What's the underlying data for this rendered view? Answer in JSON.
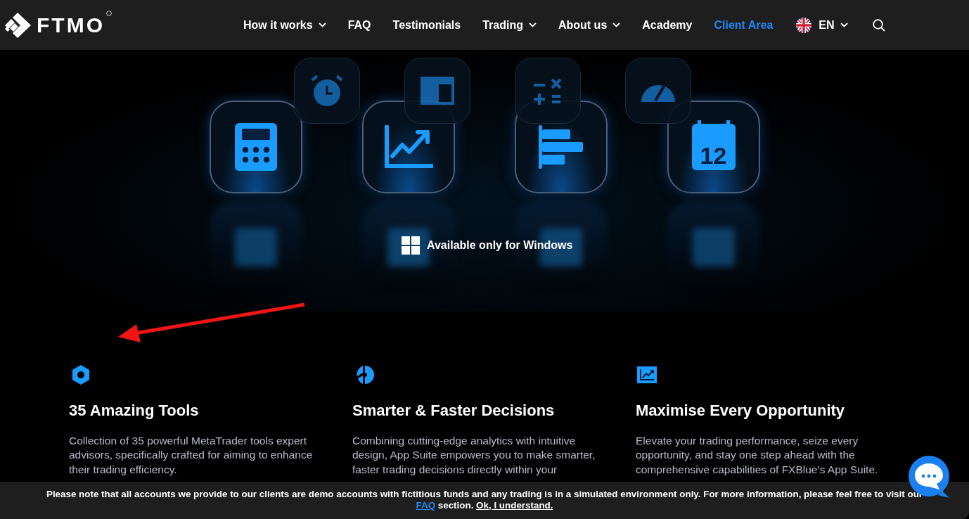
{
  "header": {
    "logo": "FTMO",
    "nav": [
      {
        "label": "How it works",
        "dropdown": true,
        "active": false
      },
      {
        "label": "FAQ",
        "dropdown": false,
        "active": false
      },
      {
        "label": "Testimonials",
        "dropdown": false,
        "active": false
      },
      {
        "label": "Trading",
        "dropdown": true,
        "active": false
      },
      {
        "label": "About us",
        "dropdown": true,
        "active": false
      },
      {
        "label": "Academy",
        "dropdown": false,
        "active": false
      },
      {
        "label": "Client Area",
        "dropdown": false,
        "active": true
      }
    ],
    "language": "EN"
  },
  "hero": {
    "calendar_day": "12",
    "platform_note": "Available only for Windows"
  },
  "features": [
    {
      "kind": "hexagon",
      "title": "35 Amazing Tools",
      "body": "Collection of 35 powerful MetaTrader tools expert advisors, specifically crafted for aiming to enhance their trading efficiency."
    },
    {
      "kind": "pie",
      "title": "Smarter & Faster Decisions",
      "body": "Combining cutting-edge analytics with intuitive design, App Suite empowers you to make smarter, faster trading decisions directly within your"
    },
    {
      "kind": "chart",
      "title": "Maximise Every Opportunity",
      "body": "Elevate your trading performance, seize every opportunity, and stay one step ahead with the comprehensive capabilities of FXBlue’s App Suite."
    }
  ],
  "notice": {
    "text": "Please note that all accounts we provide to our clients are demo accounts with fictitious funds and any trading is in a simulated environment only. For more information, please feel free to visit our",
    "link": "FAQ",
    "after": "section.",
    "dismiss": "Ok, I understand."
  }
}
